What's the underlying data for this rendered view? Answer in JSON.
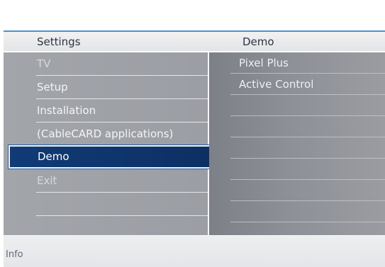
{
  "header": {
    "title": "Settings",
    "submenu_title": "Demo"
  },
  "menu": {
    "items": [
      {
        "label": "TV"
      },
      {
        "label": "Setup"
      },
      {
        "label": "Installation"
      },
      {
        "label": "(CableCARD applications)"
      },
      {
        "label": "Demo"
      },
      {
        "label": "Exit"
      }
    ],
    "selected": "Demo"
  },
  "submenu": {
    "items": [
      {
        "label": "Pixel Plus"
      },
      {
        "label": "Active Control"
      }
    ]
  },
  "footer": {
    "info": "Info"
  },
  "colors": {
    "accent": "#4a8fd8",
    "selected_bg": "#103b76",
    "left_panel": "#9f a2a7",
    "right_panel": "#7c8087"
  }
}
